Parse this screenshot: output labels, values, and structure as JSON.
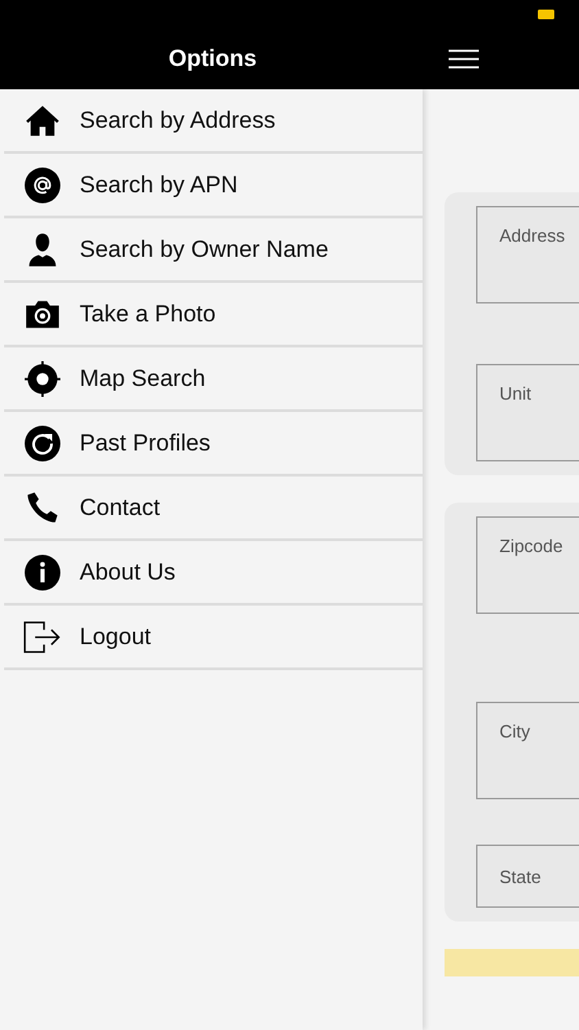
{
  "header": {
    "title": "Options"
  },
  "menu": [
    {
      "label": "Search by Address"
    },
    {
      "label": "Search by APN"
    },
    {
      "label": "Search by Owner Name"
    },
    {
      "label": "Take a Photo"
    },
    {
      "label": "Map Search"
    },
    {
      "label": "Past Profiles"
    },
    {
      "label": "Contact"
    },
    {
      "label": "About Us"
    },
    {
      "label": "Logout"
    }
  ],
  "form": {
    "cards": [
      {
        "fields": [
          {
            "placeholder": "Address",
            "kind": "tall"
          },
          {
            "placeholder": "Unit",
            "kind": "tall"
          }
        ]
      },
      {
        "fields": [
          {
            "placeholder": "Zipcode",
            "kind": "tall"
          },
          {
            "placeholder": "City",
            "kind": "tall"
          },
          {
            "placeholder": "State",
            "kind": "short"
          }
        ]
      }
    ]
  }
}
